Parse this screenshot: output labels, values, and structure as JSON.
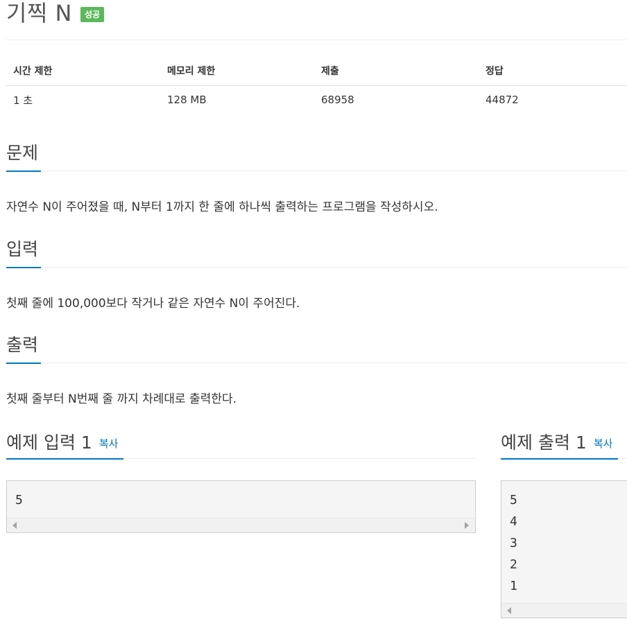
{
  "problem": {
    "title": "기찍 N",
    "status_badge": "성공"
  },
  "info_table": {
    "headers": [
      "시간 제한",
      "메모리 제한",
      "제출",
      "정답"
    ],
    "values": [
      "1 초",
      "128 MB",
      "68958",
      "44872"
    ]
  },
  "sections": {
    "description": {
      "title": "문제",
      "text": "자연수 N이 주어졌을 때, N부터 1까지 한 줄에 하나씩 출력하는 프로그램을 작성하시오."
    },
    "input": {
      "title": "입력",
      "text": "첫째 줄에 100,000보다 작거나 같은 자연수 N이 주어진다."
    },
    "output": {
      "title": "출력",
      "text": "첫째 줄부터 N번째 줄 까지 차례대로 출력한다."
    }
  },
  "samples": {
    "input": {
      "title": "예제 입력 1",
      "copy_label": "복사",
      "content": "5"
    },
    "output": {
      "title": "예제 출력 1",
      "copy_label": "복사",
      "content": "5\n4\n3\n2\n1"
    }
  },
  "colors": {
    "accent": "#0076c0",
    "success_badge": "#5cb85c",
    "sample_bg": "#f5f5f5"
  }
}
